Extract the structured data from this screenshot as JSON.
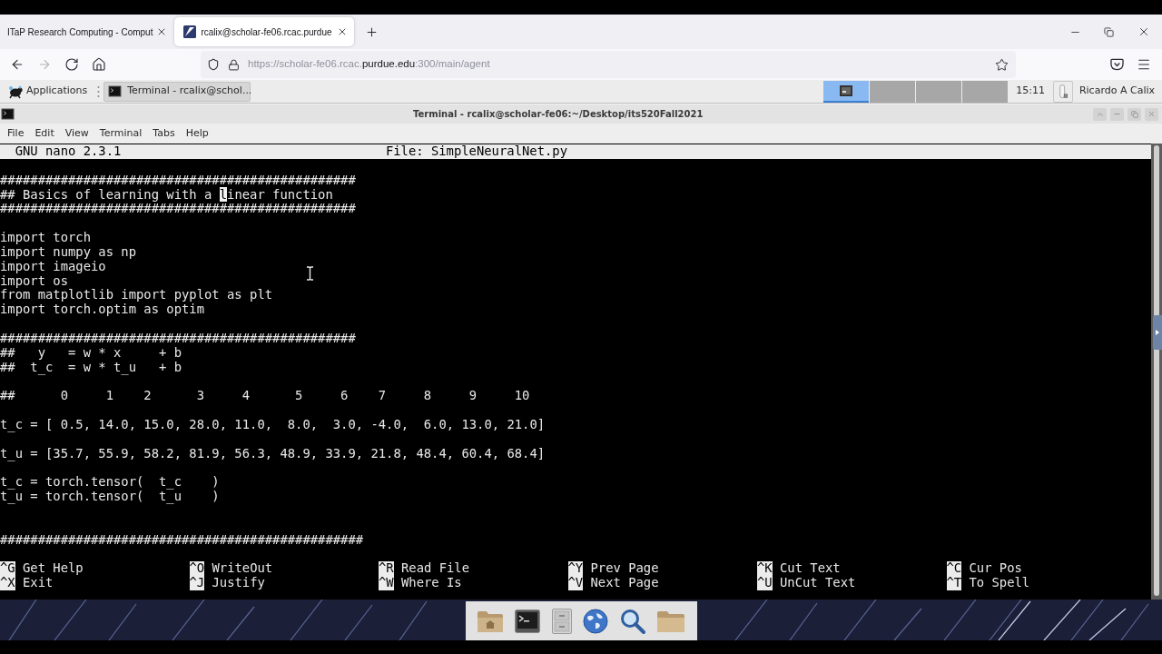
{
  "browser": {
    "tabs": [
      {
        "kind": "text",
        "title": "ITaP Research Computing - Comput",
        "selected": false
      },
      {
        "kind": "favicon",
        "title": "rcalix@scholar-fe06.rcac.purdue",
        "selected": true
      }
    ],
    "nav_buttons": [
      {
        "kind": "back",
        "disabled": false
      },
      {
        "kind": "forward",
        "disabled": true
      },
      {
        "kind": "reload",
        "disabled": false
      },
      {
        "kind": "home",
        "disabled": false
      }
    ],
    "address": {
      "prefix": "https://scholar-fe06.rcac.",
      "domain": "purdue.edu",
      "suffix": ":300/main/agent"
    }
  },
  "panel": {
    "menu": "Applications",
    "task": "Terminal - rcalix@schol...",
    "workspaces": [
      {
        "kind": "occupied",
        "selected": true
      },
      {
        "kind": "empty",
        "selected": false
      },
      {
        "kind": "empty",
        "selected": false
      },
      {
        "kind": "empty",
        "selected": false
      }
    ],
    "clock": "15:11",
    "user": "Ricardo A Calix"
  },
  "terminal": {
    "title": "Terminal - rcalix@scholar-fe06:~/Desktop/its520Fall2021",
    "menu": [
      "File",
      "Edit",
      "View",
      "Terminal",
      "Tabs",
      "Help"
    ],
    "nano": {
      "version": "GNU nano 2.3.1",
      "file": "File: SimpleNeuralNet.py",
      "lines": [
        {
          "kind": "code",
          "text": "###############################################"
        },
        {
          "kind": "cursor",
          "before": "## Basics of learning with a ",
          "cursor": "l",
          "after": "inear function"
        },
        {
          "kind": "code",
          "text": "###############################################"
        },
        {
          "kind": "blank"
        },
        {
          "kind": "code",
          "text": "import torch"
        },
        {
          "kind": "code",
          "text": "import numpy as np"
        },
        {
          "kind": "code",
          "text": "import imageio"
        },
        {
          "kind": "code",
          "text": "import os"
        },
        {
          "kind": "code",
          "text": "from matplotlib import pyplot as plt"
        },
        {
          "kind": "code",
          "text": "import torch.optim as optim"
        },
        {
          "kind": "blank"
        },
        {
          "kind": "code",
          "text": "###############################################"
        },
        {
          "kind": "code",
          "text": "##   y   = w * x     + b"
        },
        {
          "kind": "code",
          "text": "##  t_c  = w * t_u   + b"
        },
        {
          "kind": "blank"
        },
        {
          "kind": "code",
          "text": "##      0     1    2      3     4      5     6    7     8     9     10"
        },
        {
          "kind": "blank"
        },
        {
          "kind": "code",
          "text": "t_c = [ 0.5, 14.0, 15.0, 28.0, 11.0,  8.0,  3.0, -4.0,  6.0, 13.0, 21.0]"
        },
        {
          "kind": "blank"
        },
        {
          "kind": "code",
          "text": "t_u = [35.7, 55.9, 58.2, 81.9, 56.3, 48.9, 33.9, 21.8, 48.4, 60.4, 68.4]"
        },
        {
          "kind": "blank"
        },
        {
          "kind": "code",
          "text": "t_c = torch.tensor(  t_c    )"
        },
        {
          "kind": "code",
          "text": "t_u = torch.tensor(  t_u    )"
        },
        {
          "kind": "blank"
        },
        {
          "kind": "blank"
        },
        {
          "kind": "code",
          "text": "################################################"
        }
      ],
      "shortcuts": [
        {
          "key": "^G",
          "label": "Get Help"
        },
        {
          "key": "^O",
          "label": "WriteOut"
        },
        {
          "key": "^R",
          "label": "Read File"
        },
        {
          "key": "^Y",
          "label": "Prev Page"
        },
        {
          "key": "^K",
          "label": "Cut Text"
        },
        {
          "key": "^C",
          "label": "Cur Pos"
        },
        {
          "key": "^X",
          "label": "Exit"
        },
        {
          "key": "^J",
          "label": "Justify"
        },
        {
          "key": "^W",
          "label": "Where Is"
        },
        {
          "key": "^V",
          "label": "Next Page"
        },
        {
          "key": "^U",
          "label": "UnCut Text"
        },
        {
          "key": "^T",
          "label": "To Spell"
        }
      ]
    }
  }
}
